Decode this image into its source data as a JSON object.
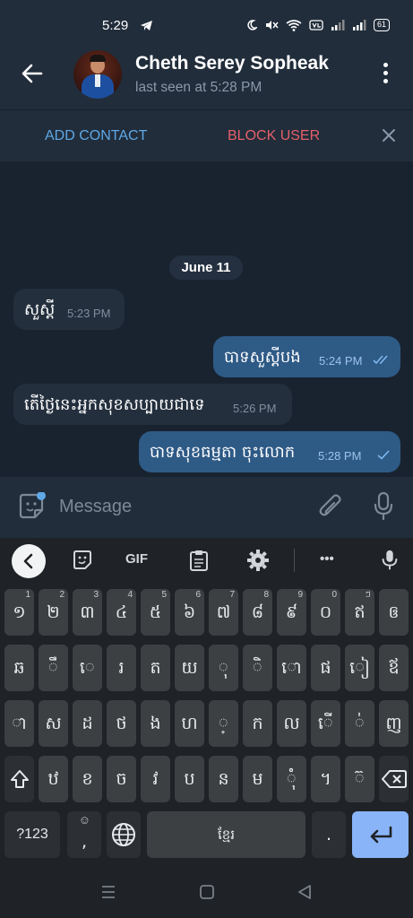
{
  "status_bar": {
    "time": "5:29",
    "battery": "61"
  },
  "header": {
    "contact_name": "Cheth Serey Sopheak",
    "last_seen": "last seen at 5:28 PM"
  },
  "action_bar": {
    "add_contact": "ADD CONTACT",
    "block_user": "BLOCK USER"
  },
  "chat": {
    "date_label": "June 11",
    "messages": [
      {
        "text": "សួស្តី",
        "time": "5:23 PM",
        "outgoing": false
      },
      {
        "text": "បាទសួស្តីបង",
        "time": "5:24 PM",
        "outgoing": true,
        "status": "read"
      },
      {
        "text": "តើថ្ងៃនេះអ្នកសុខសប្បាយជាទេ",
        "time": "5:26 PM",
        "outgoing": false
      },
      {
        "text": "បាទសុខធម្មតា ចុះលោក",
        "time": "5:28 PM",
        "outgoing": true,
        "status": "sent"
      }
    ]
  },
  "composer": {
    "placeholder": "Message"
  },
  "keyboard": {
    "toolbar": {
      "gif": "GIF",
      "more": "•••"
    },
    "row1": [
      {
        "k": "១",
        "h": "1"
      },
      {
        "k": "២",
        "h": "2"
      },
      {
        "k": "៣",
        "h": "3"
      },
      {
        "k": "៤",
        "h": "4"
      },
      {
        "k": "៥",
        "h": "5"
      },
      {
        "k": "៦",
        "h": "6"
      },
      {
        "k": "៧",
        "h": "7"
      },
      {
        "k": "៨",
        "h": "8"
      },
      {
        "k": "៩",
        "h": "9"
      },
      {
        "k": "០",
        "h": "0"
      },
      {
        "k": "ឥ",
        "h": "ៗ"
      },
      {
        "k": "ឲ",
        "h": ""
      }
    ],
    "row2": [
      "ឆ",
      "ឹ",
      "េ",
      "រ",
      "ត",
      "យ",
      "ុ",
      "ិ",
      "ោ",
      "ផ",
      "ៀ",
      "ឪ"
    ],
    "row3": [
      "ា",
      "ស",
      "ដ",
      "ថ",
      "ង",
      "ហ",
      "្",
      "ក",
      "ល",
      "ើ",
      "់",
      "ញ"
    ],
    "row4": [
      "ឋ",
      "ខ",
      "ច",
      "វ",
      "ប",
      "ន",
      "ម",
      "ុំ",
      "។",
      "៊"
    ],
    "symbols_key": "?123",
    "comma_hint": "☺",
    "comma_key": ",",
    "space_label": "ខ្មែរ",
    "period_key": "."
  },
  "colors": {
    "accent": "#5fa8e6",
    "danger": "#e5606a",
    "outgoing_bubble": "#2e5a86",
    "incoming_bubble": "#232f3d",
    "enter_key": "#8ab4f8"
  }
}
